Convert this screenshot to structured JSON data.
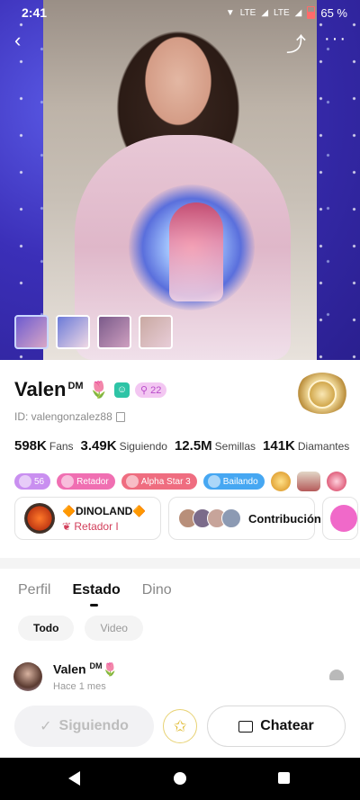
{
  "status_bar": {
    "time": "2:41",
    "network": "LTE",
    "network2": "LTE",
    "battery": "65 %"
  },
  "photos": {
    "count": 4
  },
  "profile": {
    "name": "Valen",
    "name_suffix": "DM",
    "level": "22",
    "id_label": "ID: valengonzalez88"
  },
  "stats": [
    {
      "value": "598K",
      "label": "Fans"
    },
    {
      "value": "3.49K",
      "label": "Siguiendo"
    },
    {
      "value": "12.5M",
      "label": "Semillas"
    },
    {
      "value": "141K",
      "label": "Diamantes"
    }
  ],
  "tags": {
    "gem_level": "56",
    "retador": "Retador",
    "alpha": "Alpha Star 3",
    "bailando": "Bailando"
  },
  "cards": {
    "family_name": "🔶DINOLAND🔶",
    "family_rank": "Retador I",
    "contribution": "Contribución"
  },
  "tabs": [
    "Perfil",
    "Estado",
    "Dino"
  ],
  "subtabs": [
    "Todo",
    "Video"
  ],
  "post": {
    "author": "Valen",
    "author_suffix": "DM",
    "time": "Hace 1 mes"
  },
  "actions": {
    "follow": "Siguiendo",
    "chat": "Chatear"
  },
  "colors": {
    "accent_pink": "#f069c9",
    "follow_bg": "#f2f2f4"
  }
}
